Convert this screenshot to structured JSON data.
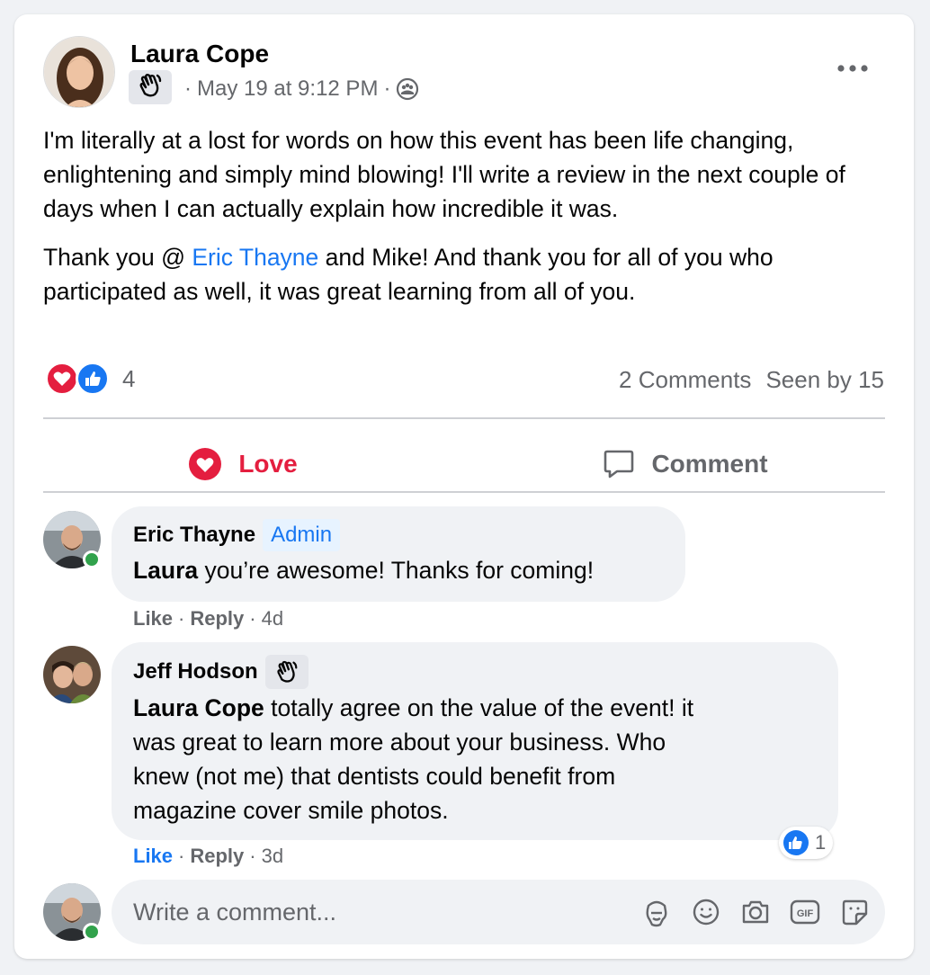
{
  "post": {
    "author": "Laura Cope",
    "timestamp": "May 19 at 9:12 PM",
    "paragraph1": "I'm literally at a lost for words on how this event has been life changing, enlightening and simply mind blowing! I'll write a review in the next couple of days when I can actually explain how incredible it was.",
    "p2_before": "Thank you @ ",
    "p2_mention": "Eric Thayne",
    "p2_after": " and Mike! And thank you for all of you who participated as well, it was great learning from all of you.",
    "reaction_count": "4",
    "comments_count": "2 Comments",
    "seen_by": "Seen by 15"
  },
  "actions": {
    "love": "Love",
    "comment": "Comment"
  },
  "comments": [
    {
      "name": "Eric Thayne",
      "badge": "Admin",
      "mention": "Laura",
      "text": " you’re awesome! Thanks for coming!",
      "like": "Like",
      "reply": "Reply",
      "time": "4d"
    },
    {
      "name": "Jeff Hodson",
      "mention": "Laura Cope",
      "line1": " totally agree on the value of the event! it",
      "line2": "was great to learn more about your business. Who",
      "line3": "knew (not me) that dentists could benefit from",
      "line4": "magazine cover smile photos.",
      "like": "Like",
      "reply": "Reply",
      "time": "3d",
      "like_count": "1"
    }
  ],
  "composer": {
    "placeholder": "Write a comment..."
  },
  "colors": {
    "accent": "#1877f2",
    "love": "#e41e3f",
    "online": "#31a24c"
  },
  "icons": {
    "wave": "wave-hand-icon",
    "audience": "group-audience-icon",
    "more": "more-horizontal-icon",
    "love": "heart-icon",
    "like": "thumbs-up-icon",
    "comment": "speech-bubble-icon",
    "composer": [
      "avatar-sticker-icon",
      "emoji-icon",
      "camera-icon",
      "gif-icon",
      "sticker-icon"
    ]
  }
}
